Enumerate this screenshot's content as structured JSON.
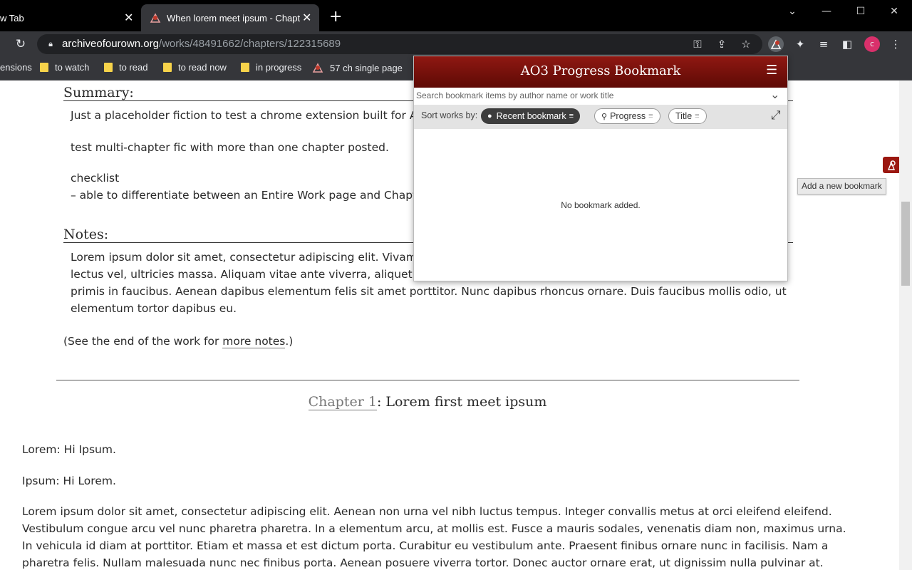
{
  "browser": {
    "tabs": [
      {
        "title": "w Tab",
        "active": false
      },
      {
        "title": "When lorem meet ipsum - Chapt",
        "active": true
      }
    ],
    "url_host": "archiveofourown.org",
    "url_path": "/works/48491662/chapters/122315689",
    "profile_initial": "c",
    "bookmarks": [
      "ensions",
      "to watch",
      "to read",
      "to read now",
      "in progress",
      "57 ch single page"
    ]
  },
  "work": {
    "summary_heading": "Summary:",
    "summary_lines": [
      "Just a placeholder fiction to test a chrome extension built for A",
      "test multi-chapter fic with more than one chapter posted.",
      "checklist",
      "– able to differentiate between an Entire Work page and Chapte"
    ],
    "notes_heading": "Notes:",
    "notes_lines": [
      "Lorem ipsum dolor sit amet, consectetur adipiscing elit. Vivam",
      "lectus vel, ultricies massa. Aliquam vitae ante viverra, aliquet d",
      "primis in faucibus. Aenean dapibus elementum felis sit amet porttitor. Nunc dapibus rhoncus ornare. Duis faucibus mollis odio, ut",
      "elementum tortor dapibus eu."
    ],
    "end_note_prefix": "(See the end of the work for ",
    "end_note_link": "more notes",
    "end_note_suffix": ".)",
    "chapter_link": "Chapter 1",
    "chapter_title": ": Lorem first meet ipsum",
    "body_lines": [
      "Lorem: Hi Ipsum.",
      "Ipsum: Hi Lorem.",
      "Lorem ipsum dolor sit amet, consectetur adipiscing elit. Aenean non urna vel nibh luctus tempus. Integer convallis metus at orci eleifend eleifend.",
      "Vestibulum congue arcu vel nunc pharetra pharetra. In a elementum arcu, at mollis est. Fusce a mauris sodales, venenatis diam non, maximus urna.",
      "In vehicula id diam at porttitor. Etiam et massa et est dictum porta. Curabitur eu vestibulum ante. Praesent finibus ornare nunc in facilisis. Nam a",
      "pharetra felis. Nullam malesuada nunc nec finibus porta. Aenean posuere viverra tortor. Donec auctor ornare erat, ut dignissim nulla pulvinar at."
    ]
  },
  "popup": {
    "title": "AO3 Progress Bookmark",
    "search_placeholder": "Search bookmark items by author name or work title",
    "sort_label": "Sort works by:",
    "sort_options": [
      "Recent bookmark",
      "Progress",
      "Title"
    ],
    "empty_message": "No bookmark added."
  },
  "floating": {
    "tooltip": "Add a new bookmark"
  },
  "colors": {
    "brand_red": "#9b1710",
    "profile_pink": "#d9306b"
  }
}
